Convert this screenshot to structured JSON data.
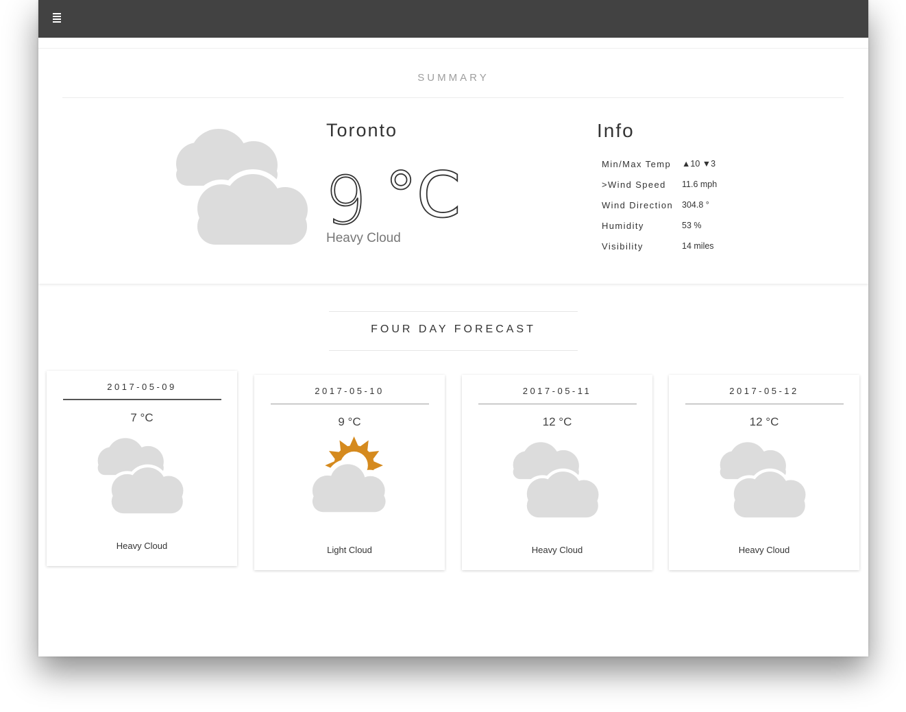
{
  "topbar": {
    "menu_icon": "hamburger-menu-icon"
  },
  "summary": {
    "title": "SUMMARY",
    "city": "Toronto",
    "temp_value": "9",
    "temp_unit": "°C",
    "condition": "Heavy Cloud",
    "icon": "heavy-cloud-icon"
  },
  "info": {
    "title": "Info",
    "rows": [
      {
        "label": "Min/Max Temp",
        "value": "▲10 ▼3"
      },
      {
        "label": ">Wind Speed",
        "value": "11.6 mph"
      },
      {
        "label": "Wind Direction",
        "value": "304.8 °"
      },
      {
        "label": "Humidity",
        "value": "53 %"
      },
      {
        "label": "Visibility",
        "value": "14 miles"
      }
    ]
  },
  "forecast": {
    "title": "FOUR DAY FORECAST",
    "days": [
      {
        "date": "2017-05-09",
        "temp": "7 °C",
        "condition": "Heavy Cloud",
        "icon": "heavy-cloud-icon"
      },
      {
        "date": "2017-05-10",
        "temp": "9 °C",
        "condition": "Light Cloud",
        "icon": "light-cloud-icon"
      },
      {
        "date": "2017-05-11",
        "temp": "12 °C",
        "condition": "Heavy Cloud",
        "icon": "heavy-cloud-icon"
      },
      {
        "date": "2017-05-12",
        "temp": "12 °C",
        "condition": "Heavy Cloud",
        "icon": "heavy-cloud-icon"
      }
    ]
  },
  "colors": {
    "topbar": "#424242",
    "cloud": "#dcdcdc",
    "sun": "#d58a1e"
  }
}
